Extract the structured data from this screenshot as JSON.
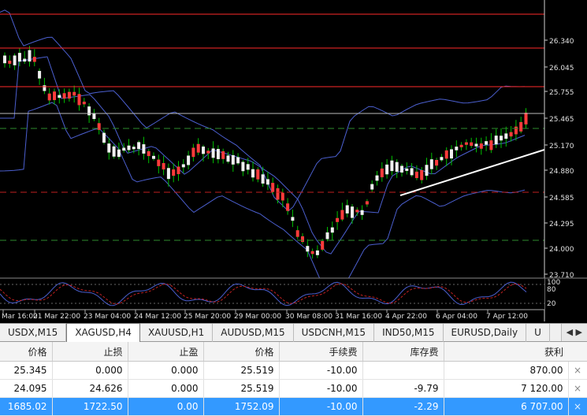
{
  "chart": {
    "symbol": "XAGUSD,H4",
    "price_labels": [
      "26.340",
      "26.045",
      "25.755",
      "25.465",
      "25.170",
      "24.880",
      "24.585",
      "24.295",
      "24.000",
      "23.710"
    ],
    "level_labels": [
      {
        "text": "26.620",
        "color": "#ff2a2a"
      },
      {
        "text": "26.240",
        "color": "#ff2a2a"
      },
      {
        "text": "25.808",
        "color": "#ff2a2a"
      }
    ],
    "current_price": "25.519",
    "time_labels": [
      "Mar 16:00",
      "21 Mar 22:00",
      "23 Mar 04:00",
      "24 Mar 12:00",
      "25 Mar 20:00",
      "29 Mar 00:00",
      "30 Mar 08:00",
      "31 Mar 16:00",
      "4 Apr 22:00",
      "6 Apr 04:00",
      "7 Apr 12:00"
    ],
    "oscillator_labels": [
      "100",
      "80",
      "20"
    ],
    "colors": {
      "bull": "#ff3b3b",
      "bear": "#f0f0f0",
      "wick": "#00c000",
      "band": "#4b5fcf",
      "green_dash": "#2e8b2e",
      "red_dash": "#c02020",
      "level": "#ff2a2a",
      "trendline": "#ffffff",
      "osc_main": "#4b5fcf",
      "osc_signal": "#c02020"
    }
  },
  "tabs": [
    {
      "label": "USDX,M15",
      "active": false
    },
    {
      "label": "XAGUSD,H4",
      "active": true
    },
    {
      "label": "XAUUSD,H1",
      "active": false
    },
    {
      "label": "AUDUSD,M15",
      "active": false
    },
    {
      "label": "USDCNH,M15",
      "active": false
    },
    {
      "label": "IND50,M15",
      "active": false
    },
    {
      "label": "EURUSD,Daily",
      "active": false
    },
    {
      "label": "U",
      "active": false
    }
  ],
  "tab_scroll": "◀ ▶",
  "orders": {
    "headers": [
      "价格",
      "止损",
      "止盈",
      "价格",
      "手续费",
      "库存费",
      "获利"
    ],
    "rows": [
      {
        "price": "25.345",
        "sl": "0.000",
        "tp": "0.000",
        "cur": "25.519",
        "fee": "-10.00",
        "swap": "",
        "profit": "870.00",
        "selected": false
      },
      {
        "price": "24.095",
        "sl": "24.626",
        "tp": "0.000",
        "cur": "25.519",
        "fee": "-10.00",
        "swap": "-9.79",
        "profit": "7 120.00",
        "selected": false
      },
      {
        "price": "1685.02",
        "sl": "1722.50",
        "tp": "0.00",
        "cur": "1752.09",
        "fee": "-10.00",
        "swap": "-2.29",
        "profit": "6 707.00",
        "selected": true
      }
    ],
    "close_glyph": "×"
  }
}
